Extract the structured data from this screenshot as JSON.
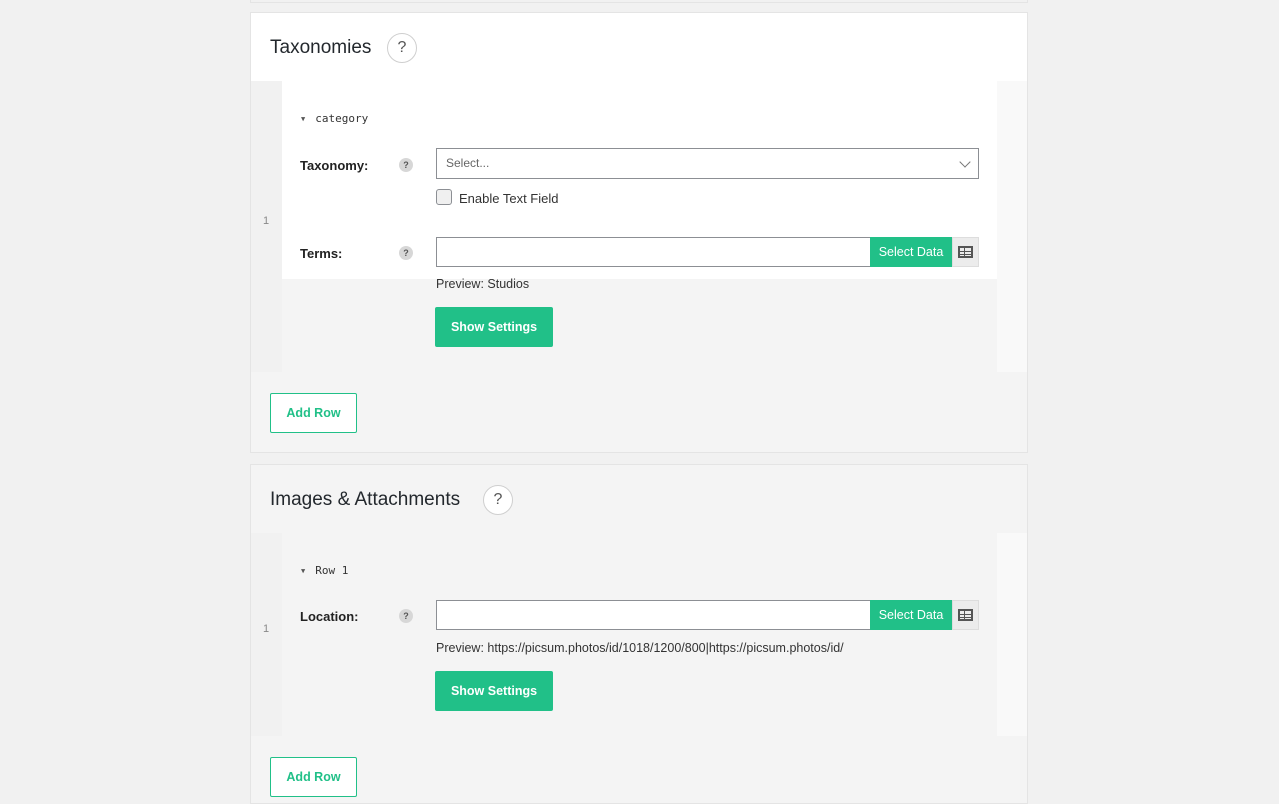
{
  "taxonomies": {
    "title": "Taxonomies",
    "help_glyph": "?",
    "row_number": "1",
    "toggle_label": "category",
    "taxonomy_label": "Taxonomy:",
    "taxonomy_placeholder": "Select...",
    "enable_text_field_label": "Enable Text Field",
    "terms_label": "Terms:",
    "terms_value": "",
    "select_data_label": "Select Data",
    "preview_text": "Preview: Studios",
    "show_settings_label": "Show Settings",
    "add_row_label": "Add Row"
  },
  "images": {
    "title": "Images & Attachments",
    "help_glyph": "?",
    "row_number": "1",
    "toggle_label": "Row 1",
    "location_label": "Location:",
    "location_value": "",
    "select_data_label": "Select Data",
    "preview_text": "Preview: https://picsum.photos/id/1018/1200/800|https://picsum.photos/id/",
    "show_settings_label": "Show Settings",
    "add_row_label": "Add Row"
  },
  "field_help_glyph": "?",
  "toggle_glyph": "▼",
  "icons": {
    "help": "question-circle-icon",
    "table": "table-icon",
    "dropdown": "chevron-down-icon",
    "toggle": "caret-down-icon"
  },
  "colors": {
    "accent": "#21c088",
    "page_background": "#f1f1f1",
    "panel_background_top": "#ffffff",
    "panel_background_bottom": "#f4f4f4"
  }
}
